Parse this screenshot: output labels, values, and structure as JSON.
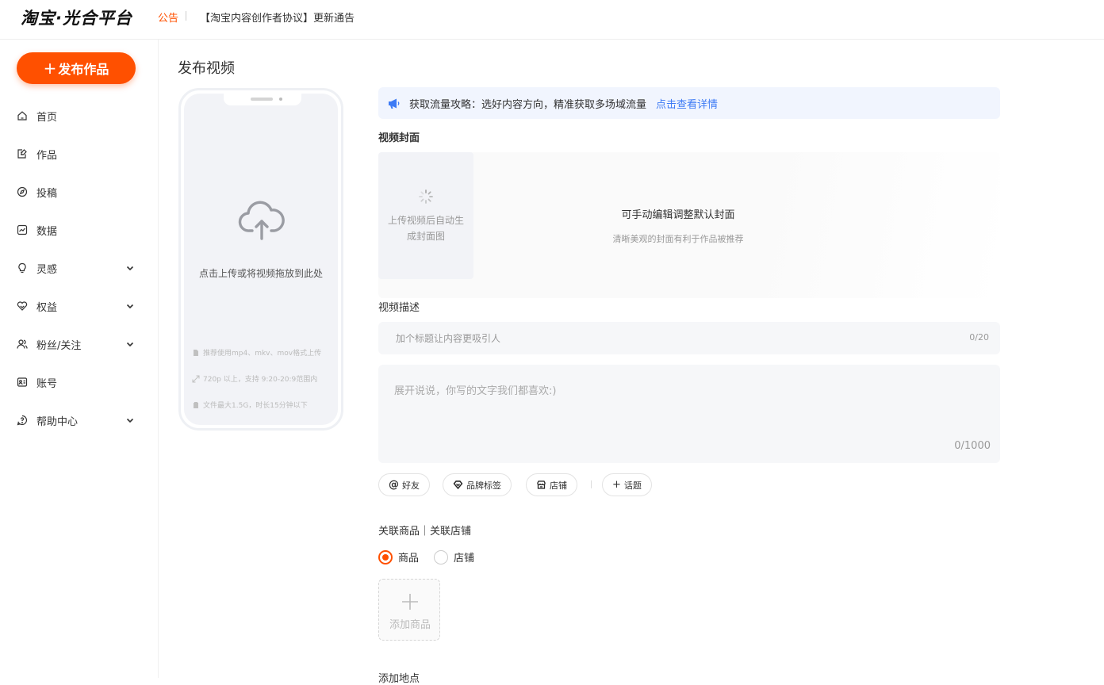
{
  "header": {
    "logo": "淘宝·光合平台",
    "notice_tag": "公告",
    "notice_text": "【淘宝内容创作者协议】更新通告"
  },
  "sidebar": {
    "publish_label": "发布作品",
    "items": [
      {
        "label": "首页",
        "icon": "home-icon",
        "expandable": false
      },
      {
        "label": "作品",
        "icon": "edit-icon",
        "expandable": false
      },
      {
        "label": "投稿",
        "icon": "compass-icon",
        "expandable": false
      },
      {
        "label": "数据",
        "icon": "chart-icon",
        "expandable": false
      },
      {
        "label": "灵感",
        "icon": "bulb-icon",
        "expandable": true
      },
      {
        "label": "权益",
        "icon": "heart-icon",
        "expandable": true
      },
      {
        "label": "粉丝/关注",
        "icon": "users-icon",
        "expandable": true
      },
      {
        "label": "账号",
        "icon": "id-card-icon",
        "expandable": false
      },
      {
        "label": "帮助中心",
        "icon": "help-icon",
        "expandable": true
      }
    ]
  },
  "main": {
    "page_title": "发布视频",
    "upload": {
      "text": "点击上传或将视频拖放到此处",
      "hints": [
        "推荐使用mp4、mkv、mov格式上传",
        "720p 以上，支持 9:20-20:9范围内",
        "文件最大1.5G，时长15分钟以下"
      ]
    },
    "banner": {
      "text": "获取流量攻略：选好内容方向，精准获取多场域流量",
      "link": "点击查看详情"
    },
    "cover": {
      "label": "视频封面",
      "thumb_text": "上传视频后自动生成封面图",
      "title": "可手动编辑调整默认封面",
      "subtitle": "清晰美观的封面有利于作品被推荐"
    },
    "description": {
      "label": "视频描述",
      "title_placeholder": "加个标题让内容更吸引人",
      "title_count": "0/20",
      "body_placeholder": "展开说说，你写的文字我们都喜欢:)",
      "body_count": "0/1000"
    },
    "chips": {
      "friend": "好友",
      "brand_tag": "品牌标签",
      "shop": "店铺",
      "topic": "话题"
    },
    "related": {
      "label": "关联商品｜关联店铺",
      "options": [
        "商品",
        "店铺"
      ],
      "selected": "商品",
      "add_product": "添加商品"
    },
    "location_label": "添加地点"
  },
  "colors": {
    "accent": "#ff5000",
    "link": "#3d7bf5",
    "banner_bg": "#f1f5fe"
  }
}
